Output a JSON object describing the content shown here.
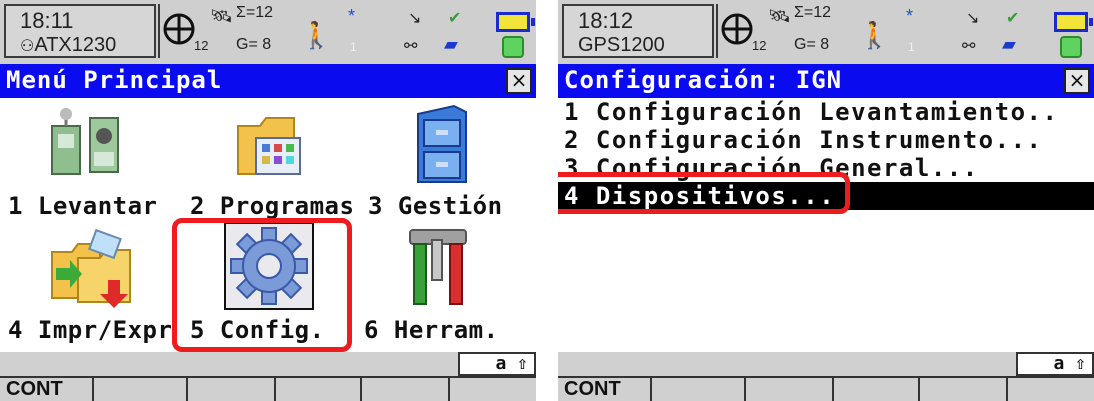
{
  "left": {
    "status": {
      "time": "18:11",
      "device": "ATX1230",
      "sv_sum": "Σ=12",
      "sv_used": "12",
      "gps": "G= 8",
      "bt": "*",
      "person_num": "1"
    },
    "title": "Menú Principal",
    "close": "×",
    "tiles": [
      {
        "label": "1 Levantar",
        "icon": "survey-instruments-icon"
      },
      {
        "label": "2 Programas",
        "icon": "programs-folder-icon"
      },
      {
        "label": "3 Gestión",
        "icon": "file-cabinet-icon"
      },
      {
        "label": "4 Impr/Expr",
        "icon": "import-export-icon"
      },
      {
        "label": "5 Config.",
        "icon": "gear-icon"
      },
      {
        "label": "6 Herram.",
        "icon": "tools-icon"
      }
    ],
    "kbd": "a ⇧",
    "fkeys": [
      "CONT",
      "",
      "",
      "",
      "",
      ""
    ]
  },
  "right": {
    "status": {
      "time": "18:12",
      "device": "GPS1200",
      "sv_sum": "Σ=12",
      "sv_used": "12",
      "gps": "G= 8",
      "bt": "*",
      "person_num": "1"
    },
    "title": "Configuración: IGN",
    "close": "×",
    "menu": [
      "1 Configuración Levantamiento..",
      "2 Configuración Instrumento...",
      "3 Configuración General...",
      "4 Dispositivos..."
    ],
    "kbd": "a ⇧",
    "fkeys": [
      "CONT",
      "",
      "",
      "",
      "",
      ""
    ]
  },
  "colors": {
    "title_bg": "#0b0bf0",
    "highlight": "#ee1c1c",
    "status_bg": "#cfcfcf"
  }
}
